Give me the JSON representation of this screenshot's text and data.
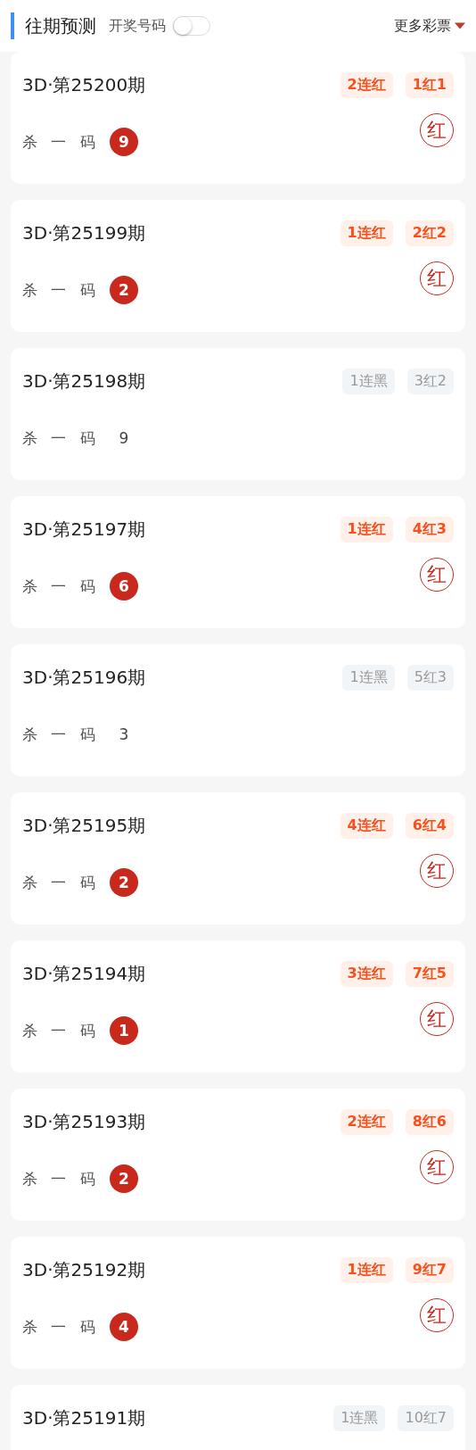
{
  "header": {
    "title": "往期预测",
    "toggle_label": "开奖号码",
    "toggle": {
      "on": false
    },
    "dropdown": "更多彩票"
  },
  "cards": [
    {
      "title": "3D·第25200期",
      "hit": true,
      "tags": [
        "2连红",
        "1红1"
      ],
      "label": "杀 一 码",
      "number": "9",
      "stamp": "红"
    },
    {
      "title": "3D·第25199期",
      "hit": true,
      "tags": [
        "1连红",
        "2红2"
      ],
      "label": "杀 一 码",
      "number": "2",
      "stamp": "红"
    },
    {
      "title": "3D·第25198期",
      "hit": false,
      "tags": [
        "1连黑",
        "3红2"
      ],
      "label": "杀 一 码",
      "number": "9"
    },
    {
      "title": "3D·第25197期",
      "hit": true,
      "tags": [
        "1连红",
        "4红3"
      ],
      "label": "杀 一 码",
      "number": "6",
      "stamp": "红"
    },
    {
      "title": "3D·第25196期",
      "hit": false,
      "tags": [
        "1连黑",
        "5红3"
      ],
      "label": "杀 一 码",
      "number": "3"
    },
    {
      "title": "3D·第25195期",
      "hit": true,
      "tags": [
        "4连红",
        "6红4"
      ],
      "label": "杀 一 码",
      "number": "2",
      "stamp": "红"
    },
    {
      "title": "3D·第25194期",
      "hit": true,
      "tags": [
        "3连红",
        "7红5"
      ],
      "label": "杀 一 码",
      "number": "1",
      "stamp": "红"
    },
    {
      "title": "3D·第25193期",
      "hit": true,
      "tags": [
        "2连红",
        "8红6"
      ],
      "label": "杀 一 码",
      "number": "2",
      "stamp": "红"
    },
    {
      "title": "3D·第25192期",
      "hit": true,
      "tags": [
        "1连红",
        "9红7"
      ],
      "label": "杀 一 码",
      "number": "4",
      "stamp": "红"
    },
    {
      "title": "3D·第25191期",
      "hit": false,
      "tags": [
        "1连黑",
        "10红7"
      ]
    }
  ]
}
